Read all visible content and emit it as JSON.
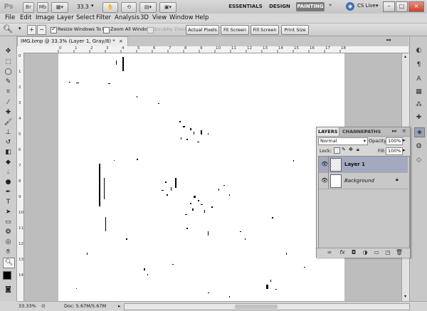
{
  "appbar": {
    "logo": "Ps",
    "zoom_value": "33.3",
    "workspaces": [
      "ESSENTIALS",
      "DESIGN",
      "PAINTING"
    ],
    "active_workspace": "PAINTING",
    "cs_live": "CS Live",
    "window_buttons": [
      "–",
      "□",
      "×"
    ]
  },
  "menu": [
    "File",
    "Edit",
    "Image",
    "Layer",
    "Select",
    "Filter",
    "Analysis",
    "3D",
    "View",
    "Window",
    "Help"
  ],
  "options": {
    "resize_windows": "Resize Windows To Fit",
    "zoom_all": "Zoom All Windows",
    "scrubby": "Scrubby Zoom",
    "buttons": [
      "Actual Pixels",
      "Fit Screen",
      "Fill Screen",
      "Print Size"
    ]
  },
  "document": {
    "tab_title": "IMG.bmp @ 33.3% (Layer 1, Gray/8) *",
    "tab_close": "×",
    "ruler_h": [
      "0",
      "1",
      "2",
      "3",
      "4",
      "5",
      "6",
      "7",
      "8",
      "9",
      "10",
      "11",
      "12",
      "13",
      "14",
      "15",
      "16",
      "17",
      "18"
    ],
    "ruler_v": [
      "0",
      "1",
      "2",
      "3",
      "4",
      "5",
      "6",
      "7",
      "8",
      "9",
      "10",
      "11",
      "12",
      "13",
      "14"
    ]
  },
  "status": {
    "zoom": "33.33%",
    "doc": "Doc: 5.67M/5.67M"
  },
  "layers_panel": {
    "tabs": [
      "LAYERS",
      "CHANNELS",
      "PATHS"
    ],
    "blend_mode": "Normal",
    "opacity_label": "Opacity:",
    "opacity_value": "100%",
    "lock_label": "Lock:",
    "fill_label": "Fill:",
    "fill_value": "100%",
    "layers": [
      {
        "name": "Layer 1",
        "selected": true
      },
      {
        "name": "Background",
        "selected": false
      }
    ]
  }
}
